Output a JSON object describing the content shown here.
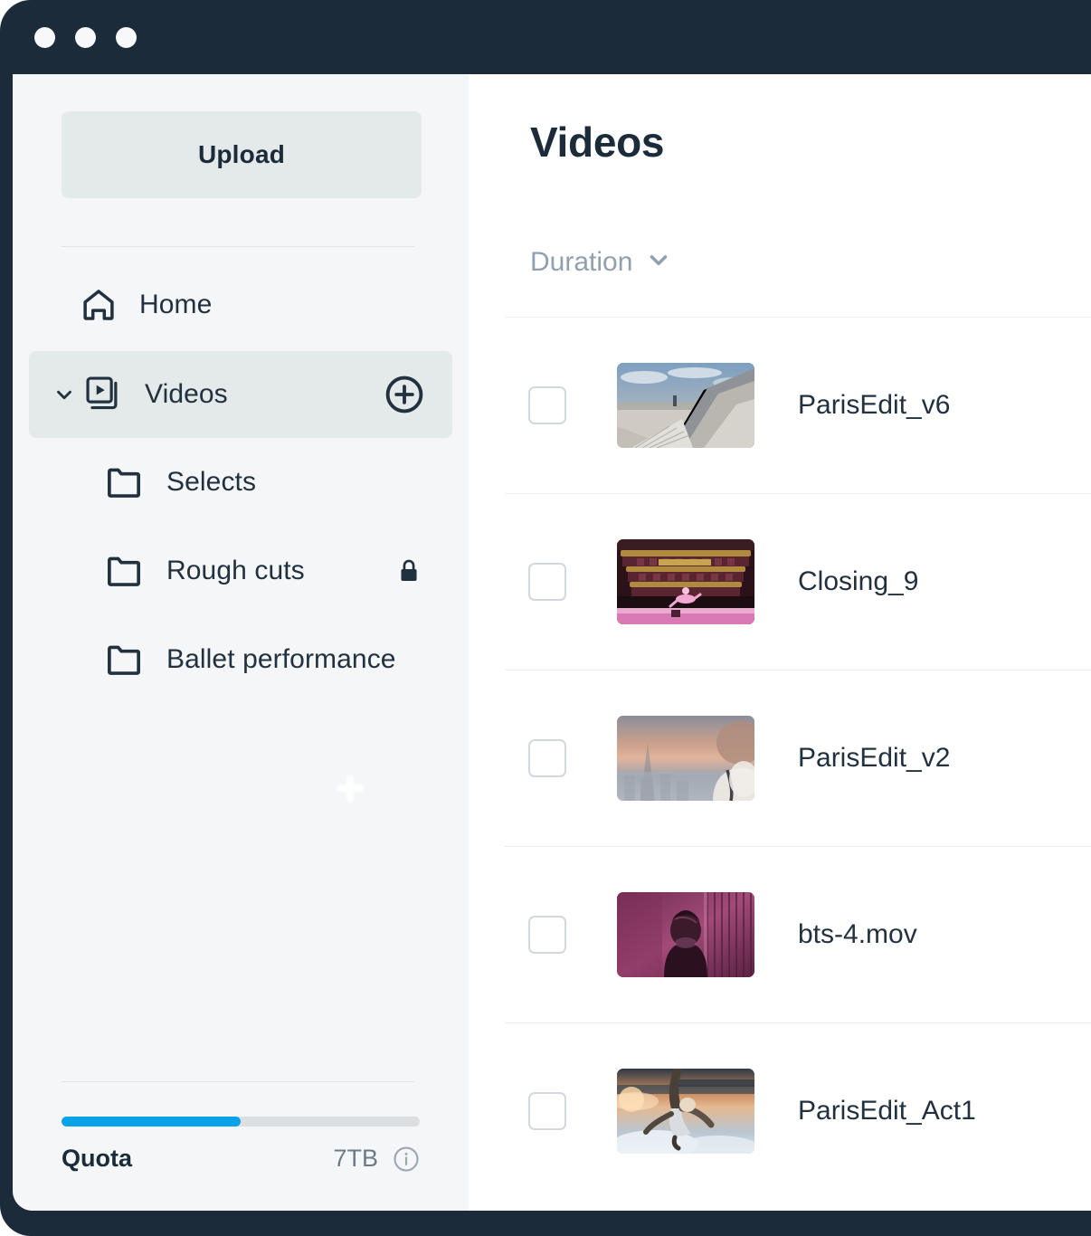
{
  "window": {
    "traffic_lights": [
      "close",
      "minimize",
      "maximize"
    ]
  },
  "sidebar": {
    "upload_label": "Upload",
    "nav": [
      {
        "label": "Home",
        "icon": "home-icon"
      },
      {
        "label": "Videos",
        "icon": "videos-icon",
        "expanded": true,
        "action_icon": "plus-circle-icon"
      },
      {
        "label": "Selects",
        "icon": "folder-icon"
      },
      {
        "label": "Rough cuts",
        "icon": "folder-icon",
        "badge_icon": "lock-icon"
      },
      {
        "label": "Ballet performance",
        "icon": "folder-icon"
      }
    ],
    "quota": {
      "label": "Quota",
      "value": "7TB",
      "percent": 50,
      "fill_color": "#0aa3e8",
      "track_color": "#dcdfe1",
      "info_icon": "info-icon"
    }
  },
  "main": {
    "title": "Videos",
    "sort": {
      "label": "Duration",
      "icon": "chevron-down-icon"
    },
    "rows": [
      {
        "name": "ParisEdit_v6",
        "checked": false,
        "thumb": "rooftop-cityscape"
      },
      {
        "name": "Closing_9",
        "checked": false,
        "thumb": "opera-house-ballerina"
      },
      {
        "name": "ParisEdit_v2",
        "checked": false,
        "thumb": "eiffel-sunset-blur"
      },
      {
        "name": "bts-4.mov",
        "checked": false,
        "thumb": "backstage-purple-dancer"
      },
      {
        "name": "ParisEdit_Act1",
        "checked": false,
        "thumb": "dancer-clouds-sunset"
      }
    ]
  },
  "colors": {
    "chrome": "#1b2b3a",
    "sidebar": "#f4f6f7",
    "sidebar_active": "#e4e9e9",
    "accent": "#0aa3e8",
    "text": "#22313f",
    "muted": "#90a0ad"
  }
}
